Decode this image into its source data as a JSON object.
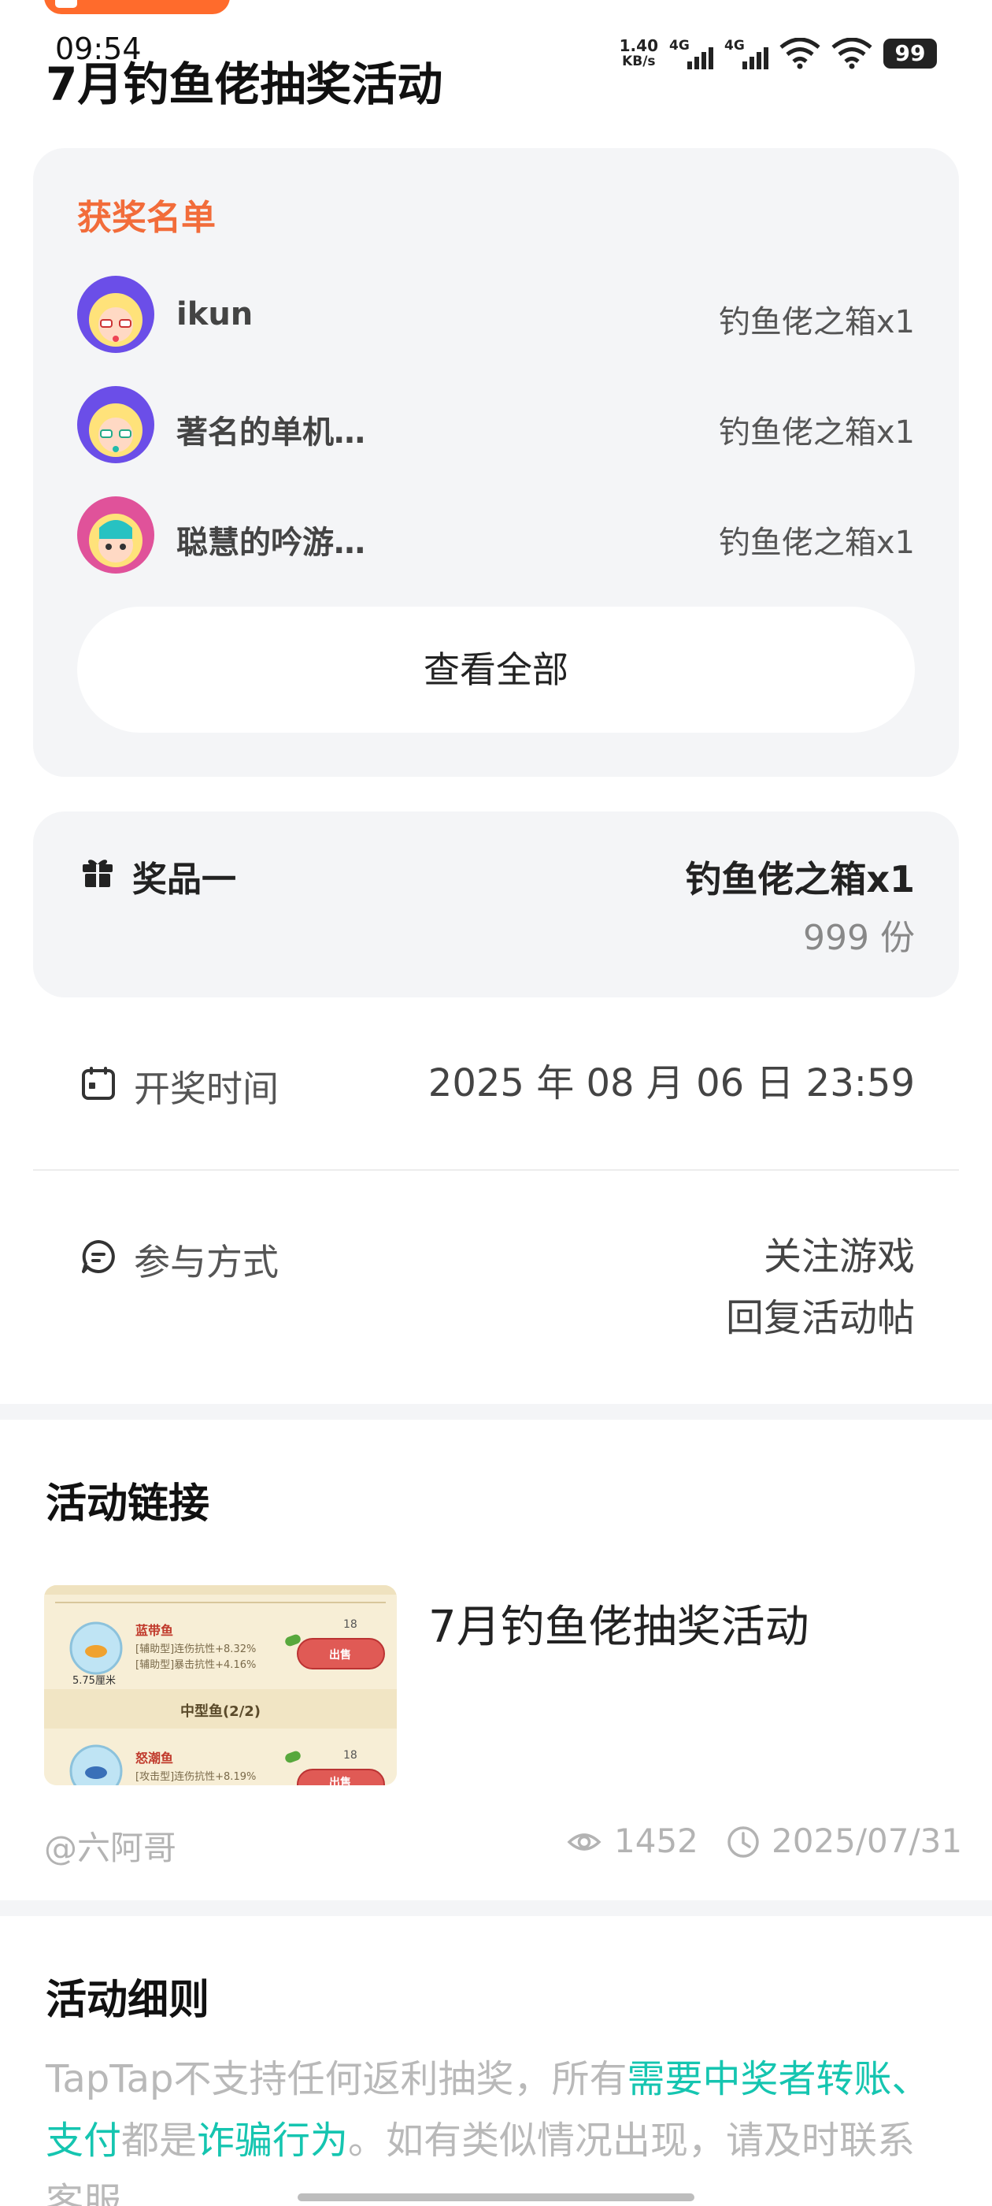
{
  "status_bar": {
    "time": "09:54",
    "net_speed_value": "1.40",
    "net_speed_unit": "KB/s",
    "signal1_label": "4G",
    "signal2_label": "4G",
    "battery": "99"
  },
  "header": {
    "title": "7月钓鱼佬抽奖活动"
  },
  "winners": {
    "title": "获奖名单",
    "items": [
      {
        "name": "ikun",
        "prize": "钓鱼佬之箱x1"
      },
      {
        "name": "著名的单机…",
        "prize": "钓鱼佬之箱x1"
      },
      {
        "name": "聪慧的吟游…",
        "prize": "钓鱼佬之箱x1"
      }
    ],
    "view_all": "查看全部"
  },
  "prize": {
    "label": "奖品一",
    "value": "钓鱼佬之箱x1",
    "count": "999 份"
  },
  "draw_time": {
    "label": "开奖时间",
    "value": "2025 年 08 月 06 日 23:59"
  },
  "participation": {
    "label": "参与方式",
    "lines": [
      "关注游戏",
      "回复活动帖"
    ]
  },
  "activity_link": {
    "section_title": "活动链接",
    "post_title": "7月钓鱼佬抽奖活动",
    "author": "@六阿哥",
    "views": "1452",
    "date": "2025/07/31",
    "thumb": {
      "row1_name": "蓝带鱼",
      "row1_stat1": "[辅助型]连伤抗性+8.32%",
      "row1_stat2": "[辅助型]暴击抗性+4.16%",
      "row1_size": "5.75厘米",
      "coin1": "18",
      "sell1": "出售",
      "category": "中型鱼(2/2)",
      "row2_name": "怒潮鱼",
      "row2_stat1": "[攻击型]连伤抗性+8.19%",
      "coin2": "18",
      "sell2": "出售"
    }
  },
  "rules": {
    "section_title": "活动细则",
    "text_1": "TapTap不支持任何返利抽奖，所有",
    "highlight_1": "需要中奖者转账、支付",
    "text_2": "都是",
    "highlight_2": "诈骗行为",
    "text_3": "。如有类似情况出现，请及时联系客服"
  },
  "colors": {
    "accent_orange": "#f26c3a",
    "accent_teal": "#15c5b0",
    "card_bg": "#f4f5f7"
  }
}
